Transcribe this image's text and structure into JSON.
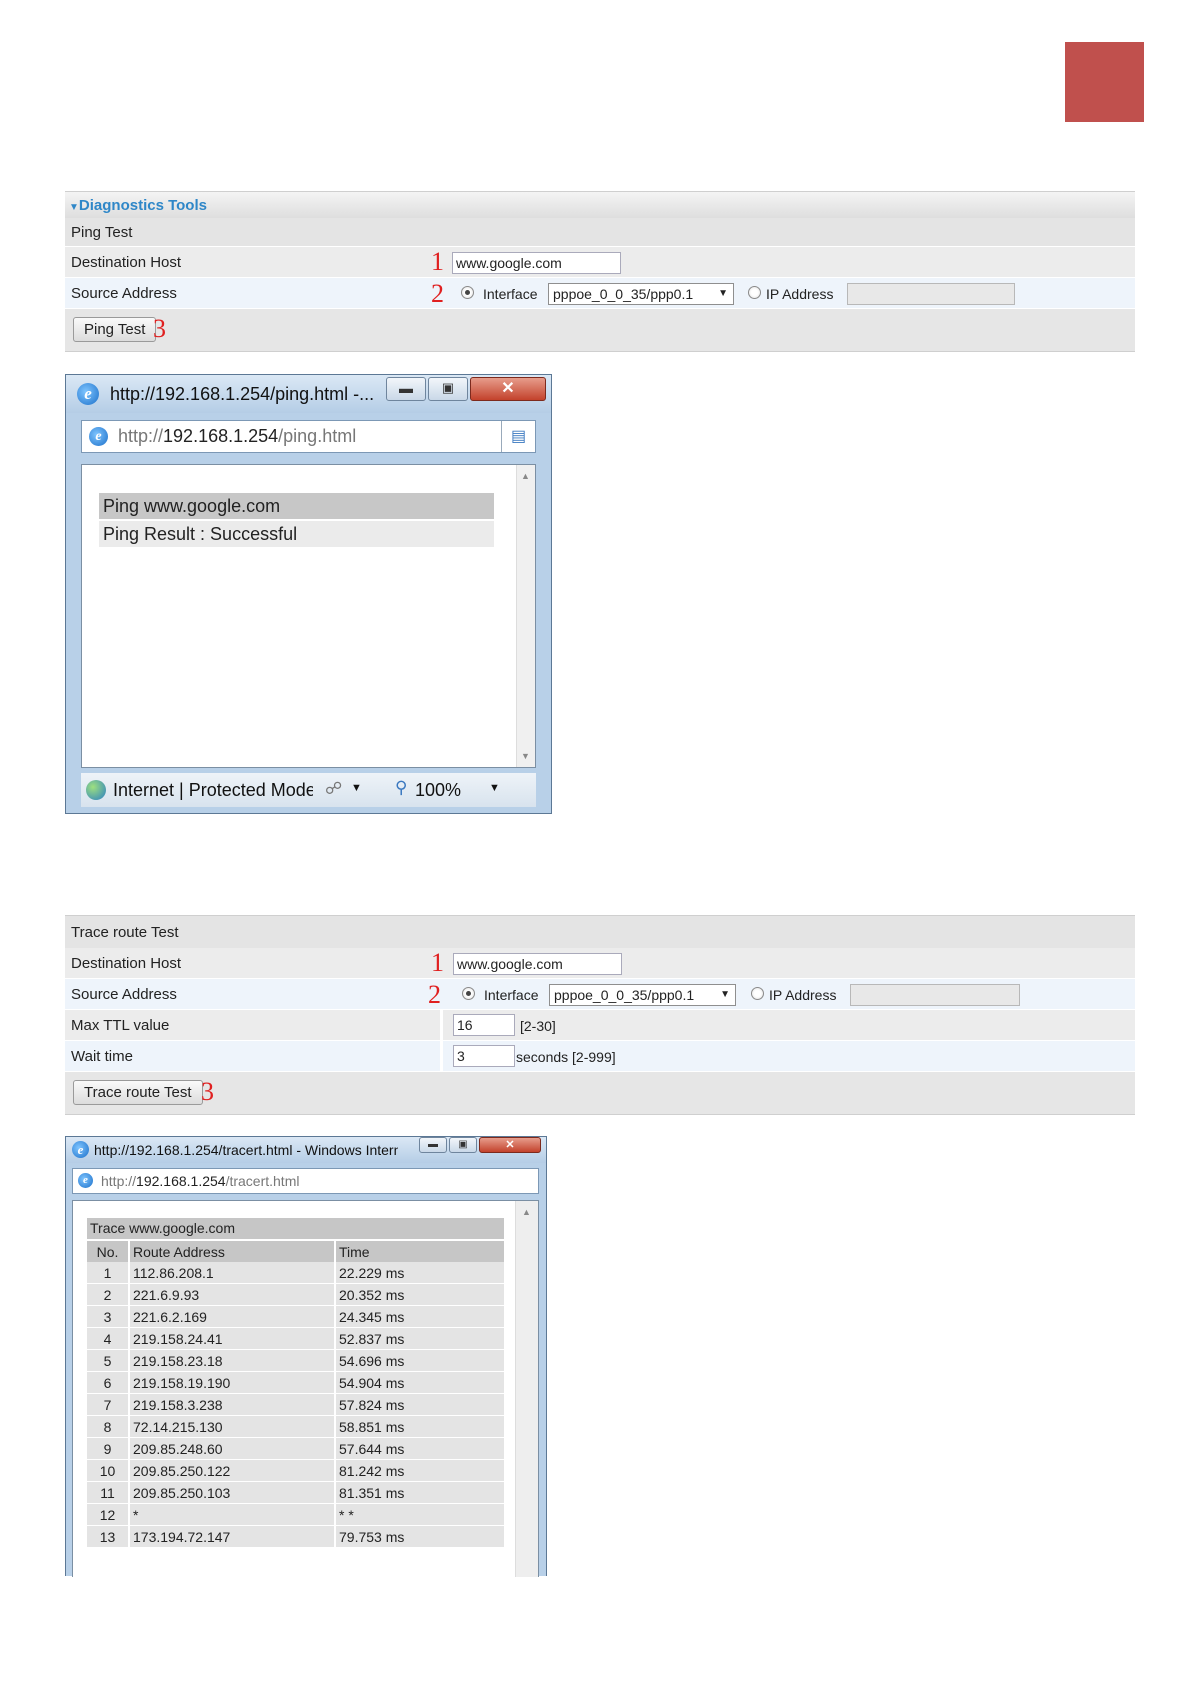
{
  "ping_panel": {
    "section_title": "Diagnostics Tools",
    "test_title": "Ping Test",
    "destination_label": "Destination Host",
    "destination_value": "www.google.com",
    "source_label": "Source Address",
    "interface_label": "Interface",
    "interface_value": "pppoe_0_0_35/ppp0.1",
    "ip_label": "IP Address",
    "button_label": "Ping Test",
    "markers": [
      "1",
      "2",
      "3"
    ]
  },
  "ping_window": {
    "title": "http://192.168.1.254/ping.html -...",
    "address_prefix": "http://",
    "address_host": "192.168.1.254",
    "address_path": "/ping.html",
    "result_heading": "Ping www.google.com",
    "result_text": "Ping Result : Successful",
    "status_zone": "Internet | Protected Mode",
    "zoom": "100%",
    "icons": [
      "ie-icon",
      "minimize-icon",
      "maximize-icon",
      "close-icon",
      "compat-view-icon",
      "globe-icon",
      "lock-icon",
      "zoom-icon"
    ]
  },
  "trace_panel": {
    "test_title": "Trace route Test",
    "destination_label": "Destination Host",
    "destination_value": "www.google.com",
    "source_label": "Source Address",
    "interface_label": "Interface",
    "interface_value": "pppoe_0_0_35/ppp0.1",
    "ip_label": "IP Address",
    "ttl_label": "Max TTL value",
    "ttl_value": "16",
    "ttl_range": "[2-30]",
    "wait_label": "Wait time",
    "wait_value": "3",
    "wait_range": "seconds [2-999]",
    "button_label": "Trace route Test",
    "markers": [
      "1",
      "2",
      "3"
    ]
  },
  "trace_window": {
    "title": "http://192.168.1.254/tracert.html - Windows Intern...",
    "address_prefix": "http://",
    "address_host": "192.168.1.254",
    "address_path": "/tracert.html",
    "table_title": "Trace www.google.com",
    "columns": [
      "No.",
      "Route Address",
      "Time"
    ],
    "rows": [
      [
        "1",
        "112.86.208.1",
        "22.229 ms"
      ],
      [
        "2",
        "221.6.9.93",
        "20.352 ms"
      ],
      [
        "3",
        "221.6.2.169",
        "24.345 ms"
      ],
      [
        "4",
        "219.158.24.41",
        "52.837 ms"
      ],
      [
        "5",
        "219.158.23.18",
        "54.696 ms"
      ],
      [
        "6",
        "219.158.19.190",
        "54.904 ms"
      ],
      [
        "7",
        "219.158.3.238",
        "57.824 ms"
      ],
      [
        "8",
        "72.14.215.130",
        "58.851 ms"
      ],
      [
        "9",
        "209.85.248.60",
        "57.644 ms"
      ],
      [
        "10",
        "209.85.250.122",
        "81.242 ms"
      ],
      [
        "11",
        "209.85.250.103",
        "81.351 ms"
      ],
      [
        "12",
        "*",
        "* *"
      ],
      [
        "13",
        "173.194.72.147",
        "79.753 ms"
      ]
    ]
  },
  "colors": {
    "accent_block": "#c0504d",
    "marker": "#e02020",
    "section_title": "#2f87c8"
  }
}
